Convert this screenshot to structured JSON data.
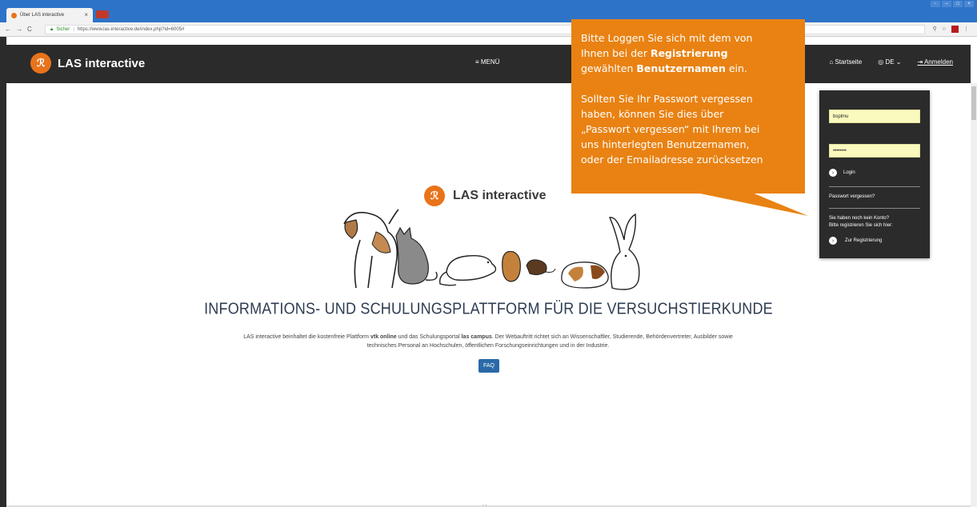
{
  "browser": {
    "tab_title": "Über LAS interactive",
    "tab_close": "×",
    "secure_label": "Sicher",
    "url": "https://www.las-interactive.de/index.php?id=6005#",
    "nav_back": "←",
    "nav_forward": "→",
    "nav_reload": "C",
    "icons": [
      "filter-icon",
      "star-icon",
      "pdf-icon",
      "menu-dots-icon"
    ]
  },
  "header": {
    "logo_glyph": "ℛ",
    "logo_text": "LAS interactive",
    "menu_label": "≡ MENÜ",
    "nav": {
      "home": "Startseite",
      "language": "DE",
      "login": "Anmelden"
    }
  },
  "main": {
    "center_logo_text": "LAS interactive",
    "headline": "INFORMATIONS- UND SCHULUNGSPLATTFORM FÜR DIE VERSUCHSTIERKUNDE",
    "desc_part1": "LAS interactive beinhaltet die kostenfreie Plattform ",
    "desc_bold1": "vtk online",
    "desc_part2": " und das Schulungsportal ",
    "desc_bold2": "las campus",
    "desc_part3": ". Der Webauftritt richtet sich an Wissenschaftler, Studierende, Behördenvertreter, Ausbilder sowie technisches Personal an Hochschulen, öffentlichen Forschungseinrichtungen und in der Industrie.",
    "faq_label": "FAQ",
    "scroll_chevron": "⌄"
  },
  "login_panel": {
    "username_value": "bsplmu",
    "password_value": "••••••••",
    "login_label": "Login",
    "forgot_label": "Passwort vergessen?",
    "no_account_line1": "Sie haben noch kein Konto?",
    "no_account_line2": "Bitte registrieren Sie sich hier:",
    "register_label": "Zur Registrierung"
  },
  "callout": {
    "l1": "Bitte Loggen Sie sich mit dem  von",
    "l2a": "Ihnen bei der ",
    "l2b": "Registrierung",
    "l3a": "gewählten ",
    "l3b": "Benutzernamen",
    "l3c": " ein.",
    "l4": "Sollten Sie Ihr Passwort vergessen",
    "l5": "haben, können Sie dies über",
    "l6": "„Passwort vergessen“ mit Ihrem bei",
    "l7": "uns hinterlegten Benutzernamen,",
    "l8": "oder der Emailadresse zurücksetzen",
    "color": "#e98213"
  },
  "colors": {
    "header_bg": "#2b2b2b",
    "accent": "#e8731a",
    "button_blue": "#2a6aa8",
    "input_yellow": "#fafabf"
  }
}
